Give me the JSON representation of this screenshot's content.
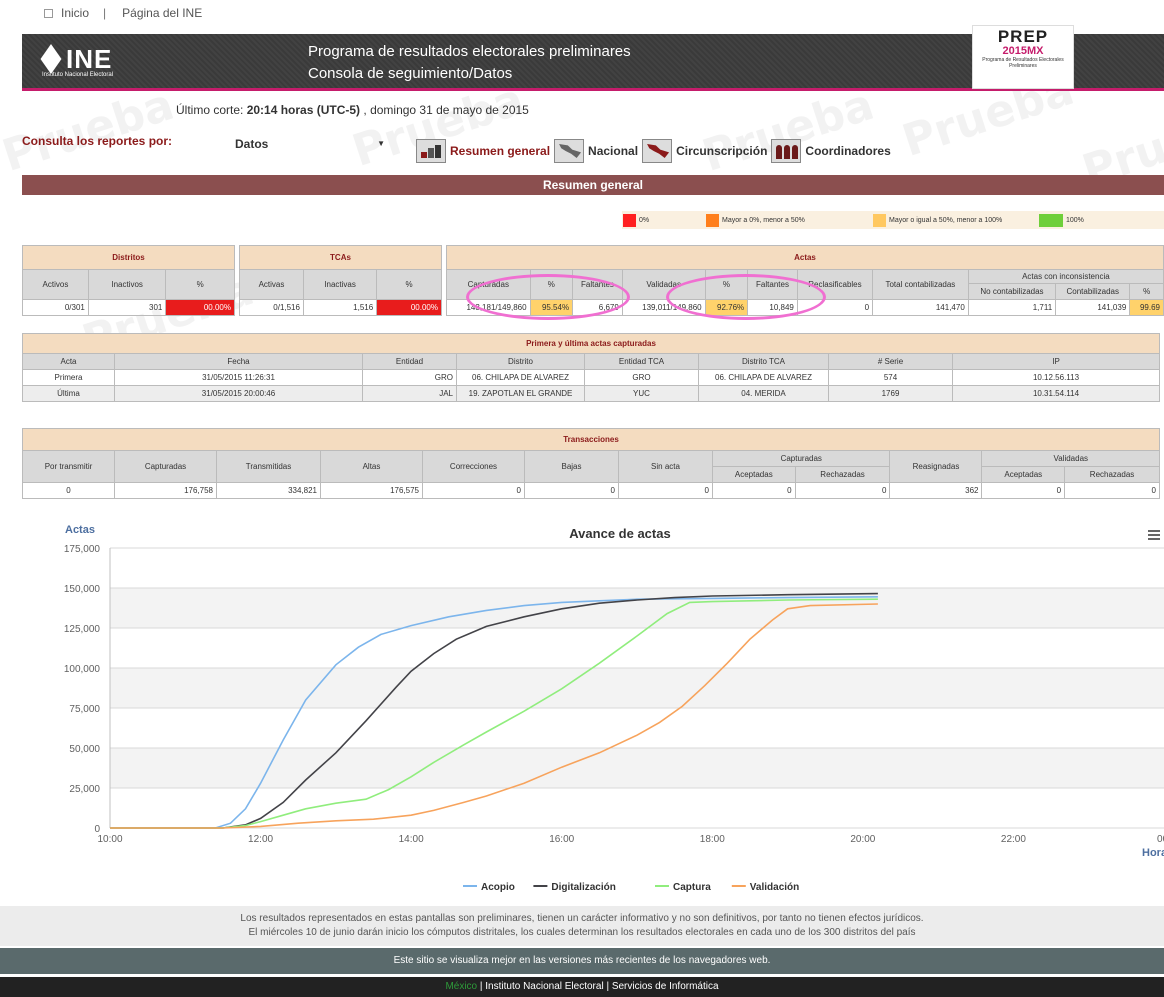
{
  "toplinks": {
    "inicio": "Inicio",
    "separator": "|",
    "pagina": "Página del INE"
  },
  "header": {
    "logo_text": "INE",
    "logo_sub": "Instituto Nacional Electoral",
    "title_line1": "Programa de resultados electorales preliminares",
    "title_line2": "Consola de seguimiento/Datos",
    "prep_line1": "PREP",
    "prep_line2": "2015MX",
    "prep_line3": "Programa de Resultados Electorales Preliminares",
    "accent": "#c51c6b"
  },
  "corte": {
    "prefix": "Último corte: ",
    "time": "20:14 horas (UTC-5)",
    "suffix": " , domingo 31 de mayo de 2015"
  },
  "consulta": {
    "label": "Consulta los reportes por:",
    "selected": "Datos"
  },
  "nav": [
    "Resumen general",
    "Nacional",
    "Circunscripción",
    "Coordinadores"
  ],
  "section_title": "Resumen general",
  "legend": [
    {
      "label": "0%",
      "color": "#ff2020"
    },
    {
      "label": "Mayor a 0%, menor a 50%",
      "color": "#ff7f1c"
    },
    {
      "label": "Mayor o igual a 50%, menor a 100%",
      "color": "#ffc860"
    },
    {
      "label": "100%",
      "color": "#6fcf3a"
    }
  ],
  "distritos": {
    "title": "Distritos",
    "headers": [
      "Activos",
      "Inactivos",
      "%"
    ],
    "values": [
      "0/301",
      "301",
      "00.00%"
    ]
  },
  "tcas": {
    "title": "TCAs",
    "headers": [
      "Activas",
      "Inactivas",
      "%"
    ],
    "values": [
      "0/1,516",
      "1,516",
      "00.00%"
    ]
  },
  "actas": {
    "title": "Actas",
    "headers": [
      "Capturadas",
      "%",
      "Faltantes",
      "Validadas",
      "%",
      "Faltantes",
      "Reclasificables",
      "Total contabilizadas"
    ],
    "inconsistencia_title": "Actas con inconsistencia",
    "inconsistencia_headers": [
      "No contabilizadas",
      "Contabilizadas",
      "%"
    ],
    "values": [
      "143,181/149,860",
      "95.54%",
      "6,679",
      "139,011/149,860",
      "92.76%",
      "10,849",
      "0",
      "141,470",
      "1,711",
      "141,039",
      "99.69"
    ]
  },
  "primera_ultima": {
    "title": "Primera y última actas capturadas",
    "headers": [
      "Acta",
      "Fecha",
      "Entidad",
      "Distrito",
      "Entidad TCA",
      "Distrito TCA",
      "# Serie",
      "IP"
    ],
    "rows": [
      [
        "Primera",
        "31/05/2015 11:26:31",
        "GRO",
        "06. CHILAPA DE ALVAREZ",
        "GRO",
        "06. CHILAPA DE ALVAREZ",
        "574",
        "10.12.56.113"
      ],
      [
        "Última",
        "31/05/2015 20:00:46",
        "JAL",
        "19. ZAPOTLAN EL GRANDE",
        "YUC",
        "04. MERIDA",
        "1769",
        "10.31.54.114"
      ]
    ]
  },
  "transacciones": {
    "title": "Transacciones",
    "headers": [
      "Por transmitir",
      "Capturadas",
      "Transmitidas",
      "Altas",
      "Correcciones",
      "Bajas",
      "Sin acta",
      "Capturadas",
      "Reasignadas",
      "Validadas"
    ],
    "sub_headers": [
      "Aceptadas",
      "Rechazadas",
      "Aceptadas",
      "Rechazadas"
    ],
    "values": [
      "0",
      "176,758",
      "334,821",
      "176,575",
      "0",
      "0",
      "0",
      "0",
      "0",
      "362",
      "0",
      "0"
    ]
  },
  "watermark": "Prueba",
  "chart_data": {
    "type": "line",
    "title": "Avance de actas",
    "ylabel": "Actas",
    "xlabel": "Hora",
    "ylim": [
      0,
      175000
    ],
    "yticks": [
      "0",
      "25,000",
      "50,000",
      "75,000",
      "100,000",
      "125,000",
      "150,000",
      "175,000"
    ],
    "xticks": [
      "10:00",
      "12:00",
      "14:00",
      "16:00",
      "18:00",
      "20:00",
      "22:00",
      "00:"
    ],
    "xlim": [
      10,
      24
    ],
    "grid": true,
    "legend_position": "bottom",
    "menu_icon": "hamburger-icon",
    "series": [
      {
        "name": "Acopio",
        "color": "#7cb5ec",
        "points": [
          [
            10,
            0
          ],
          [
            11.4,
            0
          ],
          [
            11.6,
            3000
          ],
          [
            11.8,
            12000
          ],
          [
            12,
            28000
          ],
          [
            12.3,
            55000
          ],
          [
            12.6,
            80000
          ],
          [
            13,
            102000
          ],
          [
            13.3,
            113000
          ],
          [
            13.6,
            121000
          ],
          [
            14,
            126500
          ],
          [
            14.5,
            132000
          ],
          [
            15,
            136000
          ],
          [
            15.5,
            139000
          ],
          [
            16,
            141000
          ],
          [
            16.5,
            142000
          ],
          [
            17,
            143000
          ],
          [
            18,
            143500
          ],
          [
            19,
            144000
          ],
          [
            20.2,
            144500
          ]
        ]
      },
      {
        "name": "Digitalización",
        "color": "#434348",
        "points": [
          [
            10,
            0
          ],
          [
            11.5,
            0
          ],
          [
            11.8,
            2000
          ],
          [
            12,
            6000
          ],
          [
            12.3,
            16000
          ],
          [
            12.6,
            30000
          ],
          [
            13,
            47000
          ],
          [
            13.4,
            67000
          ],
          [
            13.8,
            88000
          ],
          [
            14,
            98000
          ],
          [
            14.3,
            109000
          ],
          [
            14.6,
            118000
          ],
          [
            15,
            126000
          ],
          [
            15.5,
            132000
          ],
          [
            16,
            137000
          ],
          [
            16.5,
            140500
          ],
          [
            17,
            142500
          ],
          [
            17.5,
            144000
          ],
          [
            18,
            145000
          ],
          [
            19,
            145800
          ],
          [
            20.2,
            146500
          ]
        ]
      },
      {
        "name": "Captura",
        "color": "#90ed7d",
        "points": [
          [
            10,
            0
          ],
          [
            11.5,
            0
          ],
          [
            11.8,
            1500
          ],
          [
            12,
            4000
          ],
          [
            12.3,
            8000
          ],
          [
            12.6,
            12000
          ],
          [
            13,
            15500
          ],
          [
            13.4,
            18000
          ],
          [
            13.7,
            24000
          ],
          [
            14,
            32000
          ],
          [
            14.3,
            41000
          ],
          [
            14.7,
            52000
          ],
          [
            15,
            60000
          ],
          [
            15.5,
            73000
          ],
          [
            16,
            87000
          ],
          [
            16.5,
            103000
          ],
          [
            17,
            120000
          ],
          [
            17.4,
            134000
          ],
          [
            17.7,
            141000
          ],
          [
            18,
            141500
          ],
          [
            18.5,
            142000
          ],
          [
            19,
            142500
          ],
          [
            20.2,
            143000
          ]
        ]
      },
      {
        "name": "Validación",
        "color": "#f7a35c",
        "points": [
          [
            10,
            0
          ],
          [
            11.5,
            0
          ],
          [
            12,
            1000
          ],
          [
            12.5,
            3000
          ],
          [
            13,
            4500
          ],
          [
            13.5,
            5500
          ],
          [
            14,
            8000
          ],
          [
            14.3,
            11000
          ],
          [
            14.7,
            16000
          ],
          [
            15,
            20000
          ],
          [
            15.5,
            28000
          ],
          [
            16,
            38000
          ],
          [
            16.5,
            47000
          ],
          [
            17,
            58000
          ],
          [
            17.3,
            66000
          ],
          [
            17.6,
            76000
          ],
          [
            17.9,
            89000
          ],
          [
            18.2,
            103000
          ],
          [
            18.5,
            118000
          ],
          [
            18.8,
            130000
          ],
          [
            19,
            137000
          ],
          [
            19.3,
            139000
          ],
          [
            20.2,
            140000
          ]
        ]
      }
    ]
  },
  "footer": {
    "line1": "Los resultados representados en estas pantallas son preliminares, tienen un carácter informativo y no son definitivos, por tanto no tienen efectos jurídicos.",
    "line2": "El miércoles 10 de junio darán inicio los cómputos distritales, los cuales determinan los resultados electorales en cada uno de los 300 distritos del país",
    "browser": "Este sitio se visualiza mejor en las versiones más recientes de los navegadores web.",
    "mexico": "México",
    "bottom": " | Instituto Nacional Electoral | Servicios de Informática"
  }
}
